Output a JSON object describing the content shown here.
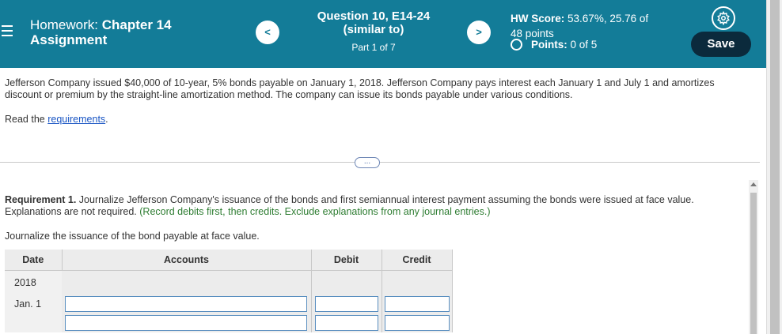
{
  "header": {
    "hw_prefix": "Homework:",
    "hw_chapter": "Chapter 14",
    "hw_assignment": "Assignment",
    "question_title_line1": "Question 10, E14-24",
    "question_title_line2": "(similar to)",
    "part": "Part 1 of 7",
    "hw_score_label": "HW Score:",
    "hw_score_value": "53.67%, 25.76 of",
    "hw_score_points": "48 points",
    "points_label": "Points:",
    "points_value": "0 of 5",
    "prev_icon": "<",
    "next_icon": ">",
    "save_label": "Save"
  },
  "problem": {
    "text": "Jefferson Company issued $40,000 of 10-year, 5% bonds payable on January 1, 2018. Jefferson Company pays interest each January 1 and July 1 and amortizes discount or premium by the straight-line amortization method. The company can issue its bonds payable under various conditions.",
    "read_prefix": "Read the ",
    "read_link": "requirements",
    "read_suffix": "."
  },
  "divider_label": "...",
  "requirement": {
    "label": "Requirement 1.",
    "text": " Journalize Jefferson Company's issuance of the bonds and first semiannual interest payment assuming the bonds were issued at face value. Explanations are not required.",
    "instruction": " (Record debits first, then credits. Exclude explanations from any journal entries.)",
    "caption": "Journalize the issuance of the bond payable at face value."
  },
  "journal": {
    "columns": [
      "Date",
      "Accounts",
      "Debit",
      "Credit"
    ],
    "year": "2018",
    "rows": [
      {
        "date": "Jan. 1",
        "account": "",
        "debit": "",
        "credit": ""
      },
      {
        "date": "",
        "account": "",
        "debit": "",
        "credit": ""
      }
    ]
  },
  "colors": {
    "header_bg": "#137c98",
    "save_bg": "#0b2a3c",
    "link": "#1a56c4",
    "instruction_green": "#2e7d32"
  }
}
